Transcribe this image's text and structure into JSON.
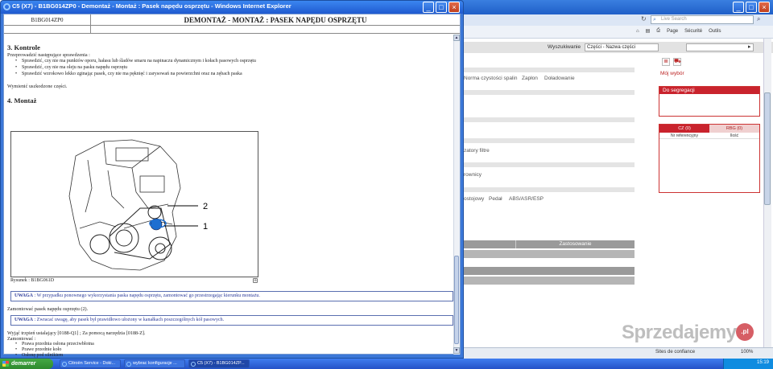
{
  "background_window": {
    "search_placeholder": "Live Search",
    "toolbar": {
      "page": "Page",
      "security": "Sécurité",
      "tools": "Outils"
    },
    "search_label": "Wyszukiwanie",
    "search_select_value": "Części - Nazwa części",
    "moj_wybor": "Mój wybór",
    "box_do_segregacji": "Do segregacji",
    "tab_cz": "CZ (0)",
    "tab_rbg": "RBG (0)",
    "col_ref": "Nr referencyjny",
    "col_qty": "Ilość",
    "menu_row1": [
      "Norma czystości spalin",
      "Zapłon",
      "Doładowanie"
    ],
    "label_filters": "zatory filtre",
    "label_drownicy": "rownicy",
    "menu_row2": [
      "ostojowy",
      "Pedał",
      "ABS/ASR/ESP"
    ],
    "zastosowanie": "Zastosowanie",
    "status_zone": "Sites de confiance",
    "zoom": "100%"
  },
  "foreground_window": {
    "title": "C5 (X7) - B1BG014ZP0 - Demontaż - Montaż : Pasek napędu osprzętu - Windows Internet Explorer",
    "doc_code": "B1BG014ZP0",
    "doc_title": "DEMONTAŻ - MONTAŻ : PASEK NAPĘDU OSPRZĘTU",
    "section3_title": "3. Kontrole",
    "section3_intro": "Przeprowadzić następujące sprawdzenia :",
    "section3_bullets": [
      "Sprawdzić, czy nie ma punktów oporu, hałasu lub śladów smaru na napinaczu dynamicznym i kołach pasowych osprzętu",
      "Sprawdzić, czy nie ma oleju na pasku napędu osprzętu",
      "Sprawdzić wzrokowo lekko zginając pasek, czy nie ma pęknięć i zarysowań na powierzchni oraz na zębach paska"
    ],
    "replace_note": "Wymienić uszkodzone części.",
    "section4_title": "4. Montaż",
    "figure_caption": "Rysunek : B1BG061D",
    "figure_label_2": "2",
    "figure_label_1": "1",
    "note1_label": "UWAGA",
    "note1_text": " : W przypadku ponownego wykorzystania paska napędu osprzętu, zamontować go przestrzegając kierunku montażu.",
    "mount_belt": "Zamontować pasek napędu osprzętu (2).",
    "note2_label": "UWAGA",
    "note2_text": " : Zwracać uwagę, aby pasek był prawidłowo ułożony w kanałkach poszczególnych kół pasowych.",
    "remove_pin": "Wyjąć trzpień ustalający [0188-Q1] ; Za pomocą narzędzia [0188-Z].",
    "mount_label": "Zamontować :",
    "mount_bullets": [
      "Prawa przednia osłona przeciwbłotna",
      "Prawe przednie koło",
      "Osłonę pod silnikiem"
    ]
  },
  "taskbar": {
    "start": "demarrer",
    "buttons": [
      "Citroën Service - Doki...",
      "wybrac konfiguracje ...",
      "C5 (X7) - B1BG014ZP..."
    ],
    "clock": "15:19"
  },
  "watermark": {
    "text": "Sprzedajemy",
    "suffix": ".pl"
  },
  "colors": {
    "accent_red": "#c9232d",
    "titlebar_blue": "#1f5ad0",
    "note_blue": "#2b3a99"
  }
}
